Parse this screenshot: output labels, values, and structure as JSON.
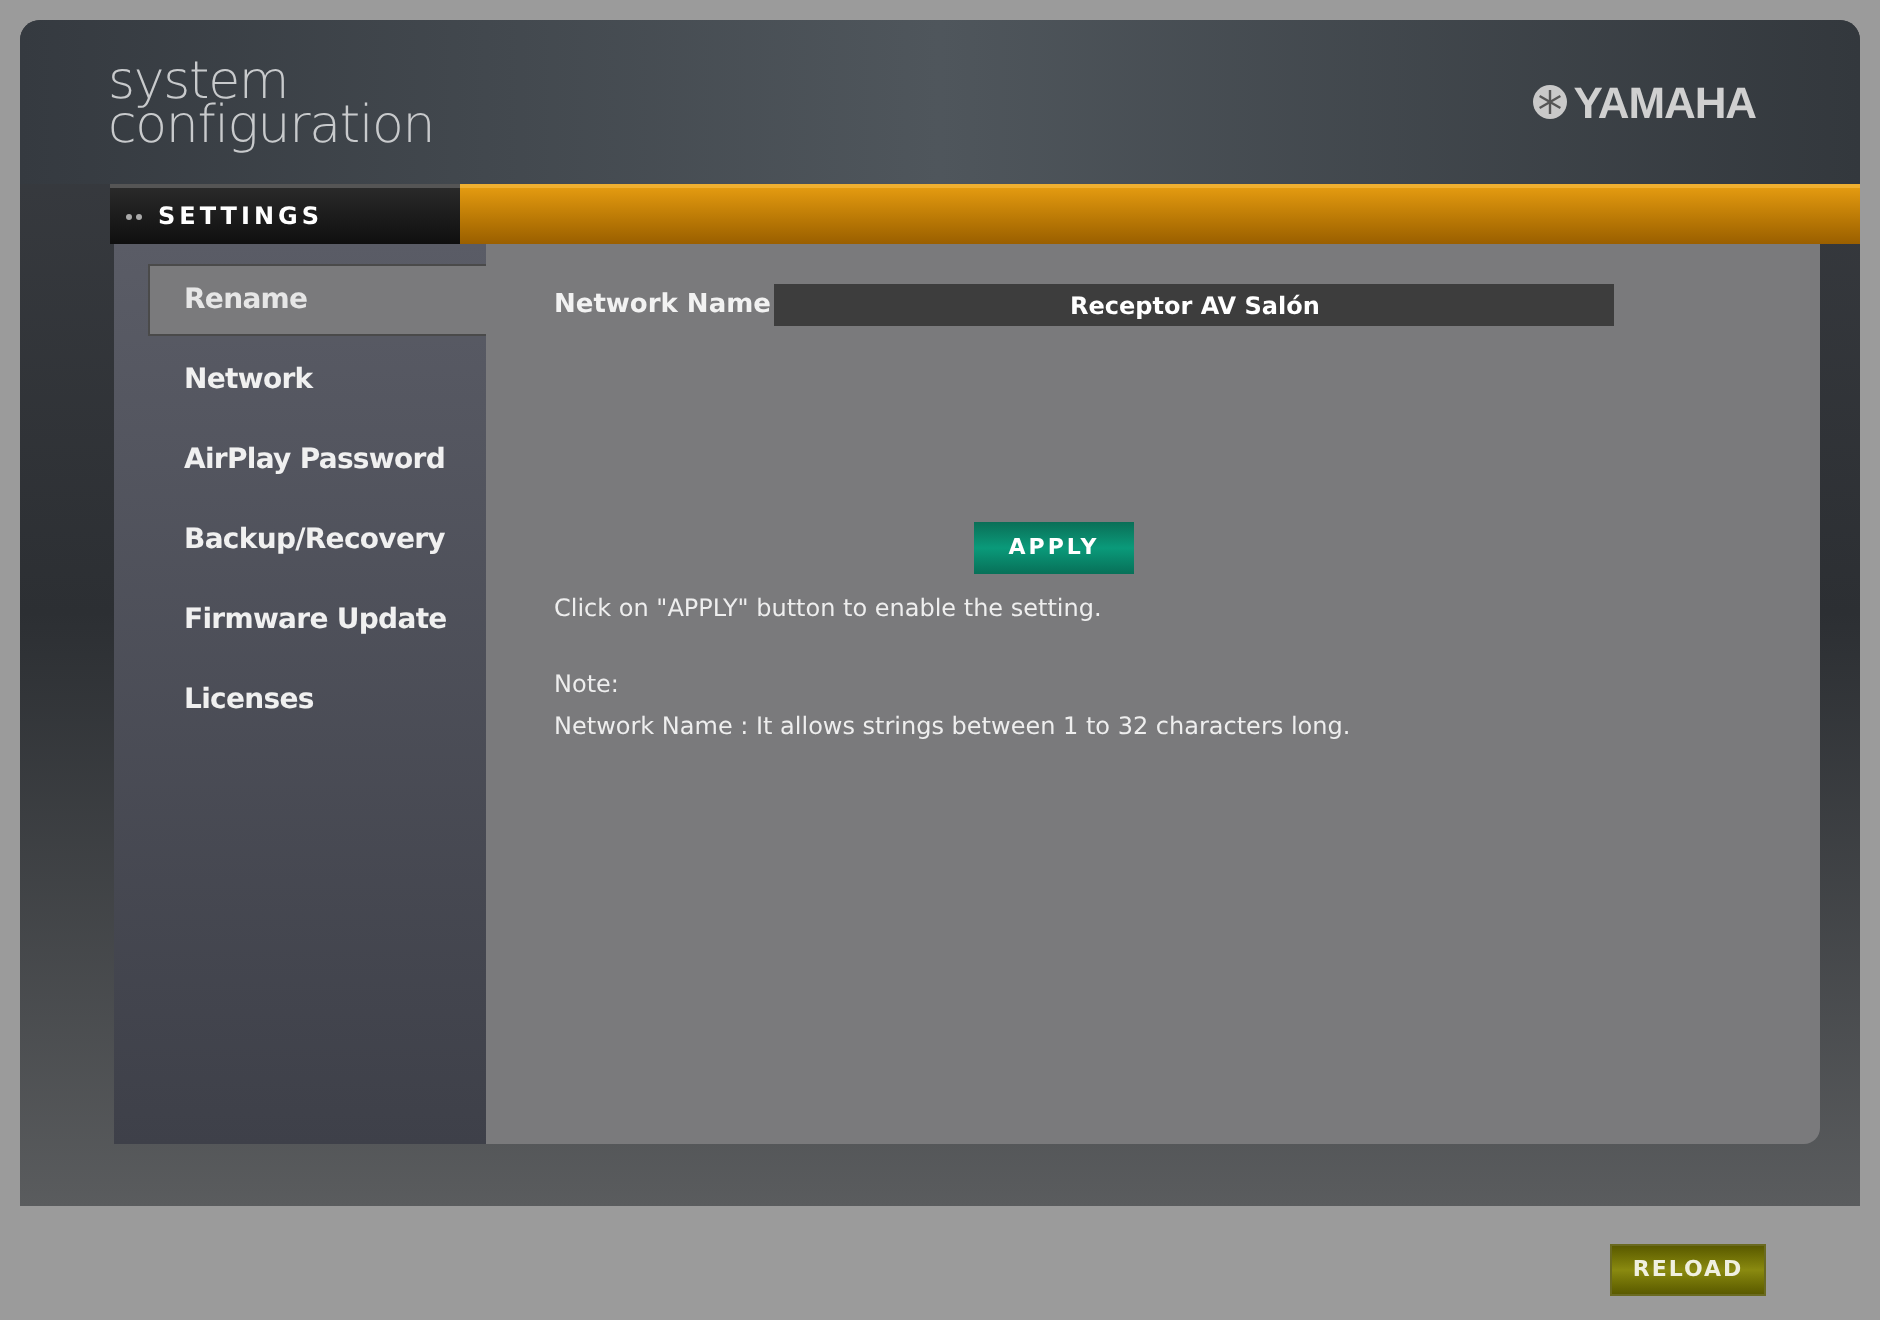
{
  "header": {
    "title_lines": [
      "system",
      "configuration"
    ],
    "brand": "YAMAHA"
  },
  "section_tab": {
    "label": "SETTINGS"
  },
  "sidebar": {
    "items": [
      {
        "label": "Rename",
        "selected": true
      },
      {
        "label": "Network",
        "selected": false
      },
      {
        "label": "AirPlay Password",
        "selected": false
      },
      {
        "label": "Backup/Recovery",
        "selected": false
      },
      {
        "label": "Firmware Update",
        "selected": false
      },
      {
        "label": "Licenses",
        "selected": false
      }
    ]
  },
  "form": {
    "field_label": "Network Name",
    "field_value": "Receptor AV Salón",
    "apply_button": "APPLY",
    "instruction": "Click on \"APPLY\" button to enable the setting.",
    "note_title": "Note:",
    "note_text": "Network Name : It allows strings between 1 to 32 characters long."
  },
  "footer": {
    "reload_button": "RELOAD"
  }
}
